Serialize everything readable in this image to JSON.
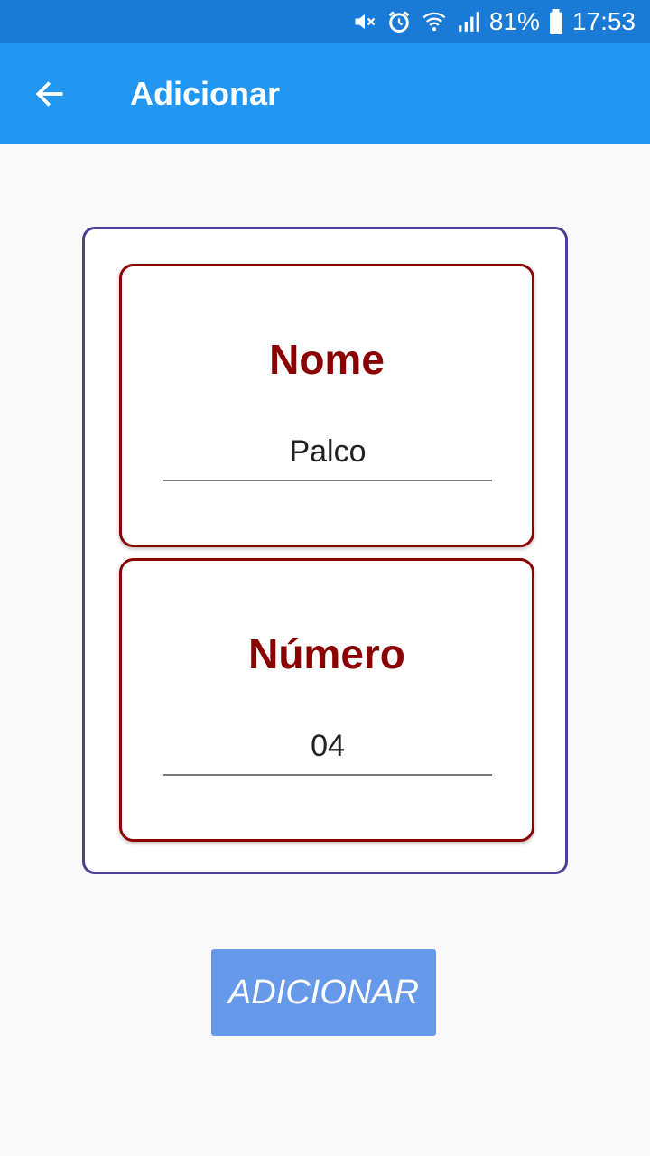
{
  "status_bar": {
    "battery": "81%",
    "time": "17:53",
    "icons": [
      "mute-icon",
      "alarm-icon",
      "wifi-icon",
      "signal-icon",
      "battery-icon"
    ]
  },
  "app_bar": {
    "title": "Adicionar",
    "back_icon": "arrow-left-icon"
  },
  "form": {
    "name_label": "Nome",
    "name_value": "Palco",
    "number_label": "Número",
    "number_value": "04"
  },
  "submit_label": "ADICIONAR",
  "colors": {
    "status_bar": "#1a7bd6",
    "app_bar": "#2196f3",
    "label_red": "#8b0000",
    "outer_border": "#4a4290",
    "button": "#6699ea"
  }
}
